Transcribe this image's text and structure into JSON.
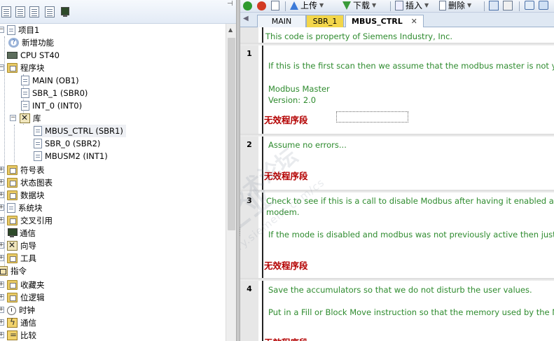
{
  "project_tree": {
    "project_label": "项目1",
    "items": [
      {
        "label": "新增功能"
      },
      {
        "label": "CPU ST40"
      },
      {
        "label": "程序块"
      },
      {
        "label": "MAIN (OB1)"
      },
      {
        "label": "SBR_1 (SBR0)"
      },
      {
        "label": "INT_0 (INT0)"
      },
      {
        "label": "库"
      },
      {
        "label": "MBUS_CTRL (SBR1)"
      },
      {
        "label": "SBR_0 (SBR2)"
      },
      {
        "label": "MBUSM2 (INT1)"
      },
      {
        "label": "符号表"
      },
      {
        "label": "状态图表"
      },
      {
        "label": "数据块"
      },
      {
        "label": "系统块"
      },
      {
        "label": "交叉引用"
      },
      {
        "label": "通信"
      },
      {
        "label": "向导"
      },
      {
        "label": "工具"
      },
      {
        "label": "指令"
      },
      {
        "label": "收藏夹"
      },
      {
        "label": "位逻辑"
      },
      {
        "label": "时钟"
      },
      {
        "label": "通信"
      },
      {
        "label": "比较"
      }
    ]
  },
  "toolbar": {
    "upload_label": "上传",
    "download_label": "下载",
    "insert_label": "插入",
    "delete_label": "删除"
  },
  "tabs": [
    {
      "label": "MAIN"
    },
    {
      "label": "SBR_1"
    },
    {
      "label": "MBUS_CTRL"
    }
  ],
  "editor": {
    "top_comment": "This code is property of Siemens Industry, Inc.",
    "invalid_label": "无效程序段",
    "networks": [
      {
        "number": "1",
        "lines": [
          "If this is the first scan then we assume that the modbus master is not yet active.",
          "Modbus Master",
          "Version: 2.0"
        ]
      },
      {
        "number": "2",
        "lines": [
          "Assume no errors..."
        ]
      },
      {
        "number": "3",
        "lines": [
          "Check to see if this is a call to disable Modbus after having it enabled at some point in the",
          "modem.",
          "If the mode is disabled and modbus was not previously active then just return."
        ]
      },
      {
        "number": "4",
        "lines": [
          "Save the accumulators so that we do not disturb the user values.",
          "Put in a Fill or Block Move instruction so that the memory used by the Modbus"
        ],
        "invalid_partial": "无效程序段"
      }
    ]
  },
  "watermark": {
    "line1": "西门子工业",
    "line2": "support.industry.siemens.com/cs",
    "line3": "技术论坛"
  }
}
